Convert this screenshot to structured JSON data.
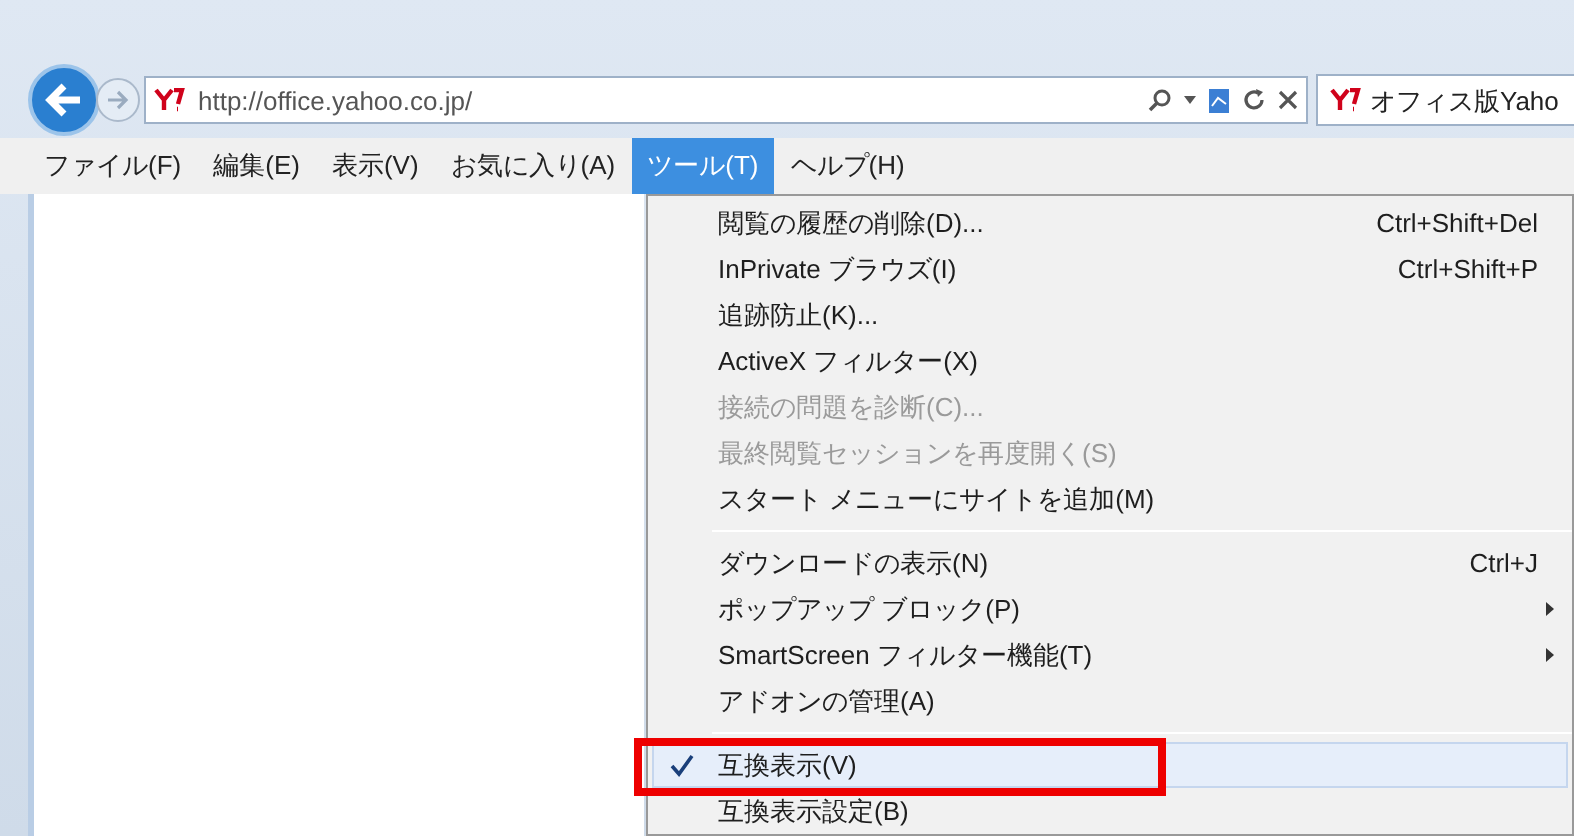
{
  "address_bar": {
    "url": "http://office.yahoo.co.jp/"
  },
  "tab": {
    "title": "オフィス版Yaho"
  },
  "menu_bar": [
    {
      "label": "ファイル(F)",
      "selected": false
    },
    {
      "label": "編集(E)",
      "selected": false
    },
    {
      "label": "表示(V)",
      "selected": false
    },
    {
      "label": "お気に入り(A)",
      "selected": false
    },
    {
      "label": "ツール(T)",
      "selected": true
    },
    {
      "label": "ヘルプ(H)",
      "selected": false
    }
  ],
  "menu": [
    {
      "kind": "item",
      "label": "閲覧の履歴の削除(D)...",
      "shortcut": "Ctrl+Shift+Del",
      "disabled": false,
      "checked": false,
      "submenu": false,
      "highlighted": false
    },
    {
      "kind": "item",
      "label": "InPrivate ブラウズ(I)",
      "shortcut": "Ctrl+Shift+P",
      "disabled": false,
      "checked": false,
      "submenu": false,
      "highlighted": false
    },
    {
      "kind": "item",
      "label": "追跡防止(K)...",
      "disabled": false,
      "checked": false,
      "submenu": false,
      "highlighted": false
    },
    {
      "kind": "item",
      "label": "ActiveX フィルター(X)",
      "disabled": false,
      "checked": false,
      "submenu": false,
      "highlighted": false
    },
    {
      "kind": "item",
      "label": "接続の問題を診断(C)...",
      "disabled": true,
      "checked": false,
      "submenu": false,
      "highlighted": false
    },
    {
      "kind": "item",
      "label": "最終閲覧セッションを再度開く(S)",
      "disabled": true,
      "checked": false,
      "submenu": false,
      "highlighted": false
    },
    {
      "kind": "item",
      "label": "スタート メニューにサイトを追加(M)",
      "disabled": false,
      "checked": false,
      "submenu": false,
      "highlighted": false
    },
    {
      "kind": "separator"
    },
    {
      "kind": "item",
      "label": "ダウンロードの表示(N)",
      "shortcut": "Ctrl+J",
      "disabled": false,
      "checked": false,
      "submenu": false,
      "highlighted": false
    },
    {
      "kind": "item",
      "label": "ポップアップ ブロック(P)",
      "disabled": false,
      "checked": false,
      "submenu": true,
      "highlighted": false
    },
    {
      "kind": "item",
      "label": "SmartScreen フィルター機能(T)",
      "disabled": false,
      "checked": false,
      "submenu": true,
      "highlighted": false
    },
    {
      "kind": "item",
      "label": "アドオンの管理(A)",
      "disabled": false,
      "checked": false,
      "submenu": false,
      "highlighted": false
    },
    {
      "kind": "separator"
    },
    {
      "kind": "item",
      "label": "互換表示(V)",
      "disabled": false,
      "checked": true,
      "submenu": false,
      "highlighted": true
    },
    {
      "kind": "item",
      "label": "互換表示設定(B)",
      "disabled": false,
      "checked": false,
      "submenu": false,
      "highlighted": false
    }
  ]
}
